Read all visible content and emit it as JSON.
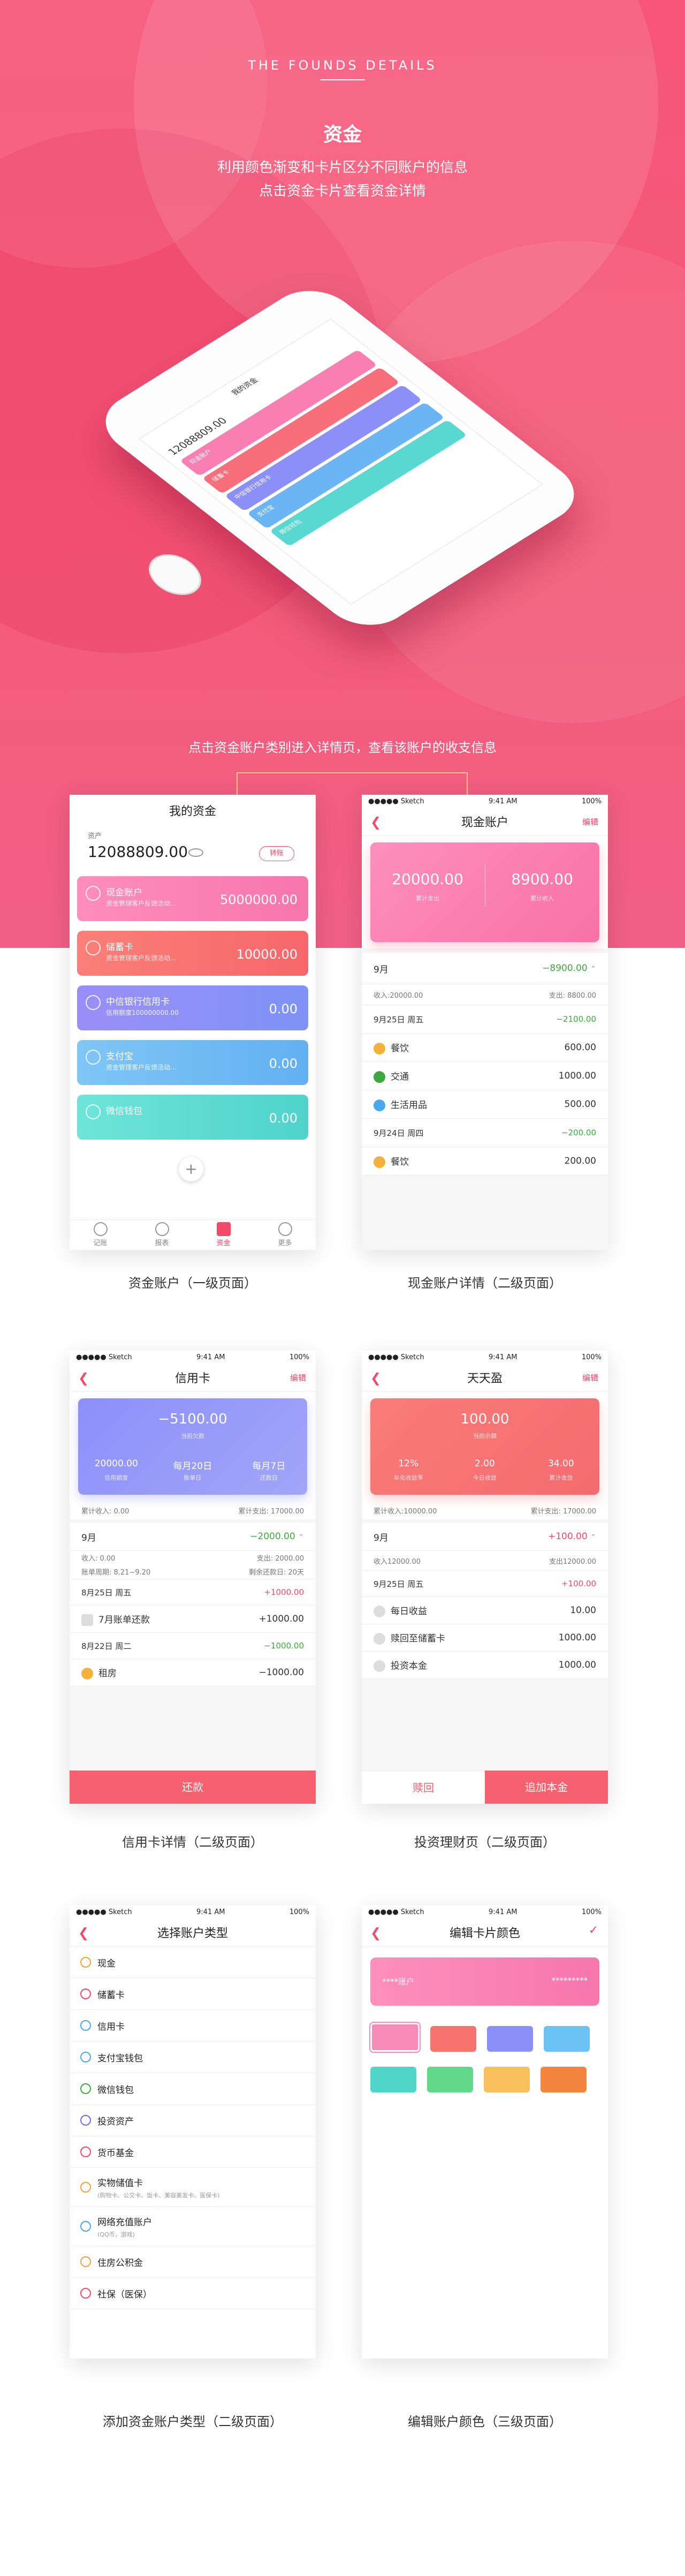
{
  "hero": {
    "subtitle": "THE FOUNDS   DETAILS",
    "title": "资金",
    "desc_line1": "利用颜色渐变和卡片区分不同账户的信息",
    "desc_line2": "点击资金卡片查看资金详情",
    "mid_text": "点击资金账户类别进入详情页，查看该账户的收支信息"
  },
  "phone_mock": {
    "title": "我的资金",
    "balance": "12088809.00",
    "cards": [
      {
        "label": "现金账户",
        "color": "#f97fb2"
      },
      {
        "label": "储蓄卡",
        "color": "#f86f7b"
      },
      {
        "label": "中信银行信用卡",
        "color": "#8c8ff8"
      },
      {
        "label": "支付宝",
        "color": "#6bb5f5"
      },
      {
        "label": "微信钱包",
        "color": "#58d8d0"
      }
    ]
  },
  "colors": {
    "accent": "#f44a6a",
    "pink": "#f97fb2",
    "coral": "#f86f7b",
    "purple": "#8c8ff8",
    "blue": "#6bb5f5",
    "teal": "#58d8d0",
    "green": "#3caa3c"
  },
  "status": {
    "carrier": "●●●●● Sketch",
    "time": "9:41 AM",
    "battery": "100%"
  },
  "screen1": {
    "title": "我的资金",
    "total_label": "资产",
    "total": "12088809.00",
    "transfer": "转账",
    "cards": [
      {
        "name": "现金账户",
        "sub": "资金管理客户反馈活动...",
        "amount": "5000000.00"
      },
      {
        "name": "储蓄卡",
        "sub": "资金管理客户反馈活动...",
        "amount": "10000.00"
      },
      {
        "name": "中信银行信用卡",
        "sub": "信用额度100000000.00",
        "amount": "0.00"
      },
      {
        "name": "支付宝",
        "sub": "资金管理客户反馈活动...",
        "amount": "0.00"
      },
      {
        "name": "微信钱包",
        "sub": "",
        "amount": "0.00"
      }
    ],
    "add_icon": "plus-icon",
    "tabs": [
      "记账",
      "报表",
      "资金",
      "更多"
    ],
    "caption": "资金账户（一级页面）"
  },
  "screen2": {
    "title": "现金账户",
    "edit": "编辑",
    "card_left_value": "20000.00",
    "card_left_label": "累计支出",
    "card_right_value": "8900.00",
    "card_right_label": "累计收入",
    "month": "9月",
    "month_total": "−8900.00",
    "month_in": "收入:20000.00",
    "month_out": "支出: 8800.00",
    "groups": [
      {
        "date": "9月25日 周五",
        "total": "−2100.00",
        "items": [
          {
            "name": "餐饮",
            "amount": "600.00",
            "color": "#f4b13c"
          },
          {
            "name": "交通",
            "amount": "1000.00",
            "color": "#3caa3c"
          },
          {
            "name": "生活用品",
            "amount": "500.00",
            "color": "#4aa8f0"
          }
        ]
      },
      {
        "date": "9月24日 周四",
        "total": "−200.00",
        "items": [
          {
            "name": "餐饮",
            "amount": "200.00",
            "color": "#f4b13c"
          }
        ]
      }
    ],
    "caption": "现金账户详情（二级页面）"
  },
  "screen3": {
    "title": "信用卡",
    "edit": "编辑",
    "card_main_value": "−5100.00",
    "card_main_label": "当前欠款",
    "stats": [
      {
        "value": "20000.00",
        "label": "信用额度"
      },
      {
        "value": "每月20日",
        "label": "账单日"
      },
      {
        "value": "每月7日",
        "label": "还款日"
      }
    ],
    "in_total": "累计收入: 0.00",
    "out_total": "累计支出: 17000.00",
    "month": "9月",
    "month_total": "−2000.00",
    "sub_in": "收入: 0.00",
    "sub_out": "支出: 2000.00",
    "sub_period": "账单周期: 8.21−9.20",
    "sub_due": "剩余还款日: 20天",
    "rows": [
      {
        "label": "8月25日 周五",
        "amount": "+1000.00",
        "type": "date-red"
      },
      {
        "label": "7月账单还款",
        "amount": "+1000.00",
        "type": "item"
      },
      {
        "label": "8月22日 周二",
        "amount": "−1000.00",
        "type": "date-green"
      },
      {
        "label": "租房",
        "amount": "−1000.00",
        "type": "item"
      }
    ],
    "button": "还款",
    "caption": "信用卡详情（二级页面）"
  },
  "screen4": {
    "title": "天天盈",
    "edit": "编辑",
    "card_main_value": "100.00",
    "card_main_label": "当前余额",
    "stats": [
      {
        "value": "12%",
        "label": "年化收益率"
      },
      {
        "value": "2.00",
        "label": "今日收益"
      },
      {
        "value": "34.00",
        "label": "累计收益"
      }
    ],
    "in_total": "累计收入:10000.00",
    "out_total": "累计支出: 17000.00",
    "month": "9月",
    "month_total": "+100.00",
    "sub_in": "收入12000.00",
    "sub_out": "支出12000.00",
    "date": "9月25日 周五",
    "date_total": "+100.00",
    "items": [
      {
        "name": "每日收益",
        "amount": "10.00"
      },
      {
        "name": "赎回至储蓄卡",
        "amount": "1000.00"
      },
      {
        "name": "投资本金",
        "amount": "1000.00"
      }
    ],
    "button_left": "赎回",
    "button_right": "追加本金",
    "caption": "投资理财页（二级页面）"
  },
  "screen5": {
    "title": "选择账户类型",
    "items": [
      {
        "name": "现金",
        "sub": "",
        "color": "#f4a13c"
      },
      {
        "name": "储蓄卡",
        "sub": "",
        "color": "#f44a6a"
      },
      {
        "name": "信用卡",
        "sub": "",
        "color": "#4aa8f0"
      },
      {
        "name": "支付宝钱包",
        "sub": "",
        "color": "#4aa8f0"
      },
      {
        "name": "微信钱包",
        "sub": "",
        "color": "#3caa3c"
      },
      {
        "name": "投资资产",
        "sub": "",
        "color": "#6b6bf0"
      },
      {
        "name": "货币基金",
        "sub": "",
        "color": "#f44a6a"
      },
      {
        "name": "实物储值卡",
        "sub": "(购物卡、公交卡、饭卡、美容美发卡、医保卡)",
        "color": "#f4a13c"
      },
      {
        "name": "网络充值账户",
        "sub": "(QQ币，游戏)",
        "color": "#4aa8f0"
      },
      {
        "name": "住房公积金",
        "sub": "",
        "color": "#f4a13c"
      },
      {
        "name": "社保（医保）",
        "sub": "",
        "color": "#f44a6a"
      }
    ],
    "caption": "添加资金账户类型（二级页面）"
  },
  "screen6": {
    "title": "编辑卡片颜色",
    "card_name": "****账户",
    "card_number": "*********",
    "swatches": [
      "#f98bb8",
      "#f8726e",
      "#8a90f8",
      "#6bc2f5",
      "#4fd6c8",
      "#62d98a",
      "#f8c15e",
      "#f5843e"
    ],
    "caption": "编辑账户颜色（三级页面）"
  }
}
